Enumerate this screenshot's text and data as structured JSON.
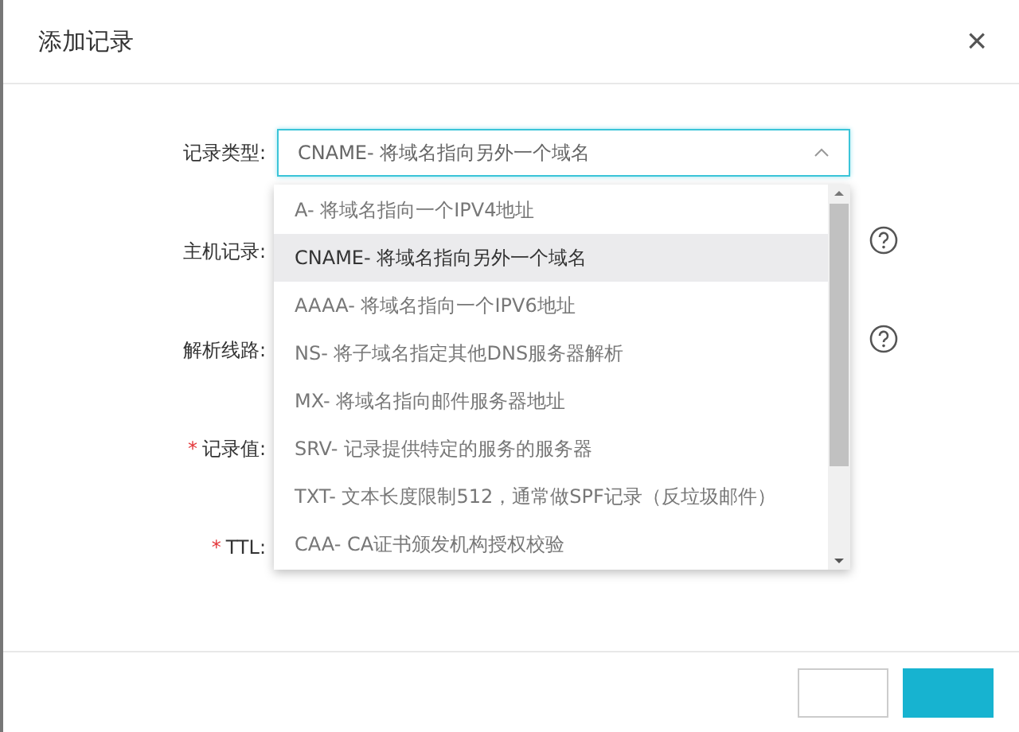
{
  "dialog": {
    "title": "添加记录",
    "close": "×"
  },
  "form": {
    "fields": [
      {
        "label": "记录类型:",
        "help": false
      },
      {
        "label": "主机记录:",
        "help": true
      },
      {
        "label": "解析线路:",
        "help": true
      },
      {
        "required_mark": "*",
        "label": "记录值:",
        "help": false
      },
      {
        "required_mark": "*",
        "label": "TTL:",
        "help": false
      }
    ],
    "record_type": {
      "code": "CNAME",
      "description": "- 将域名指向另外一个域名",
      "expanded": true
    }
  },
  "dropdown": {
    "options": [
      {
        "code": "A",
        "description": "- 将域名指向一个IPV4地址",
        "selected": false
      },
      {
        "code": "CNAME",
        "description": "- 将域名指向另外一个域名",
        "selected": true
      },
      {
        "code": "AAAA",
        "description": "- 将域名指向一个IPV6地址",
        "selected": false
      },
      {
        "code": "NS",
        "description": "- 将子域名指定其他DNS服务器解析",
        "selected": false
      },
      {
        "code": "MX",
        "description": "- 将域名指向邮件服务器地址",
        "selected": false
      },
      {
        "code": "SRV",
        "description": "- 记录提供特定的服务的服务器",
        "selected": false
      },
      {
        "code": "TXT",
        "description": "- 文本长度限制512，通常做SPF记录（反垃圾邮件）",
        "selected": false
      },
      {
        "code": "CAA",
        "description": "- CA证书颁发机构授权校验",
        "selected": false
      }
    ]
  },
  "footer": {
    "buttons": [
      {
        "kind": "secondary"
      },
      {
        "kind": "primary"
      }
    ]
  }
}
